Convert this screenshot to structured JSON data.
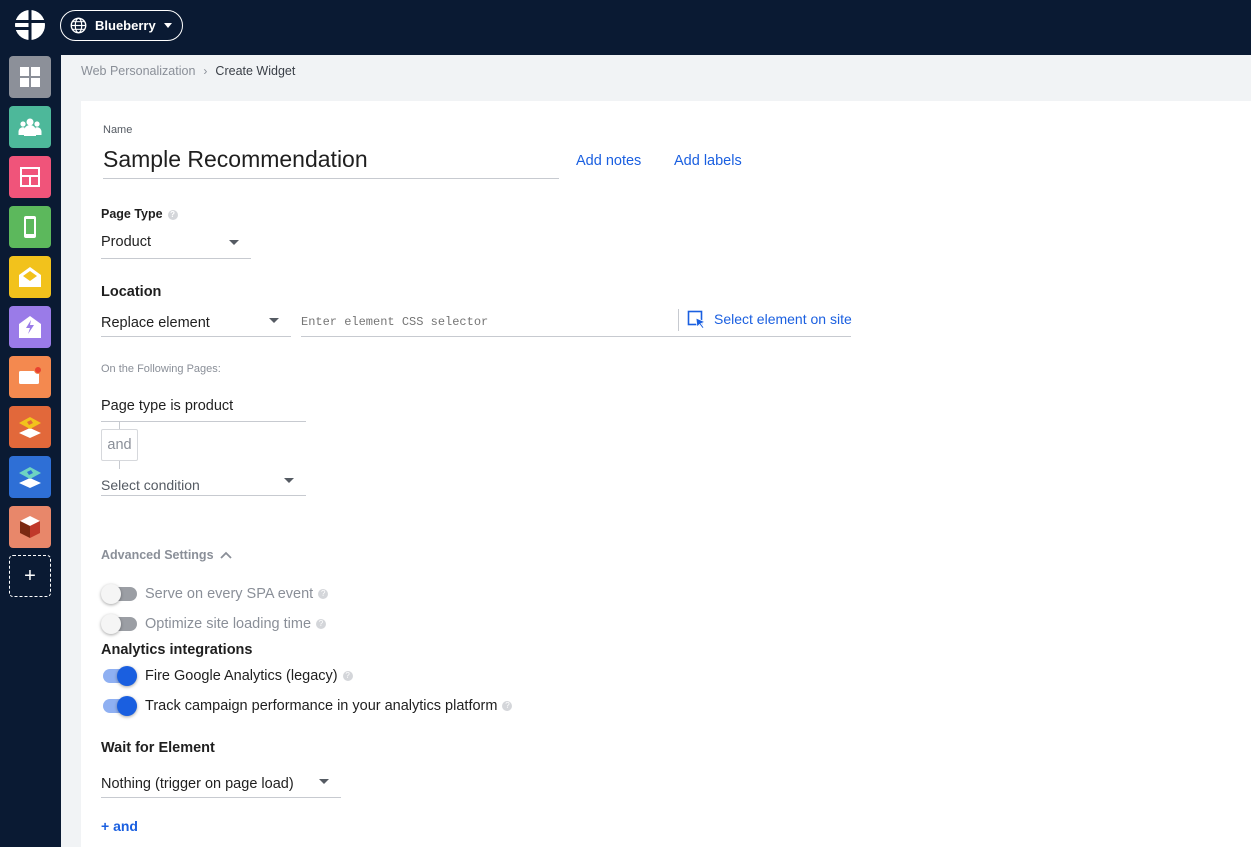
{
  "topbar": {
    "account_name": "Blueberry",
    "logo_icon": "app-logo-icon",
    "account_icon": "globe-icon"
  },
  "sidebar": {
    "items": [
      {
        "name": "dashboard",
        "icon": "grid-icon",
        "color": "#8c9099"
      },
      {
        "name": "audiences",
        "icon": "people-icon",
        "color": "#4db89a"
      },
      {
        "name": "web-personalization",
        "icon": "layout-icon",
        "color": "#f0547a"
      },
      {
        "name": "mobile",
        "icon": "mobile-icon",
        "color": "#5cb85c"
      },
      {
        "name": "email",
        "icon": "envelope-icon",
        "color": "#f2c21c"
      },
      {
        "name": "triggered-email",
        "icon": "lightning-envelope-icon",
        "color": "#9a7be8"
      },
      {
        "name": "notifications",
        "icon": "notification-icon",
        "color": "#f4894f"
      },
      {
        "name": "stack-orange",
        "icon": "layers-icon",
        "color": "#e2683a"
      },
      {
        "name": "stack-blue",
        "icon": "layers-icon",
        "color": "#2e6fd6"
      },
      {
        "name": "products",
        "icon": "cube-icon",
        "color": "#e8876a"
      }
    ],
    "add_label": "+"
  },
  "breadcrumb": {
    "parent": "Web Personalization",
    "separator": "›",
    "current": "Create Widget"
  },
  "form": {
    "name_label": "Name",
    "name_value": "Sample Recommendation",
    "add_notes": "Add notes",
    "add_labels": "Add labels",
    "page_type_label": "Page Type",
    "page_type_value": "Product",
    "location_label": "Location",
    "location_value": "Replace element",
    "css_selector_placeholder": "Enter element CSS selector",
    "select_element_label": "Select element on site",
    "following_pages_label": "On the Following Pages:",
    "condition_1": "Page type is product",
    "and_label": "and",
    "select_condition": "Select condition",
    "advanced_settings_label": "Advanced Settings",
    "serve_spa_label": "Serve on every SPA event",
    "serve_spa_on": false,
    "optimize_label": "Optimize site loading time",
    "optimize_on": false,
    "analytics_title": "Analytics integrations",
    "fire_ga_label": "Fire Google Analytics (legacy)",
    "fire_ga_on": true,
    "track_label": "Track campaign performance in your analytics platform",
    "track_on": true,
    "wait_title": "Wait for Element",
    "wait_value": "Nothing (trigger on page load)",
    "add_and_label": "+ and",
    "help_icon": "question-icon"
  }
}
